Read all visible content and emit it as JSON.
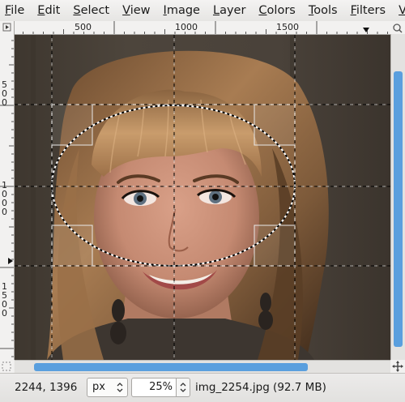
{
  "menubar": {
    "items": [
      {
        "mnemonic": "F",
        "rest": "ile"
      },
      {
        "mnemonic": "E",
        "rest": "dit"
      },
      {
        "mnemonic": "S",
        "rest": "elect"
      },
      {
        "mnemonic": "V",
        "rest": "iew"
      },
      {
        "mnemonic": "I",
        "rest": "mage"
      },
      {
        "mnemonic": "L",
        "rest": "ayer"
      },
      {
        "mnemonic": "C",
        "rest": "olors"
      },
      {
        "mnemonic": "T",
        "rest": "ools"
      },
      {
        "mnemonic": "F",
        "rest": "ilters"
      },
      {
        "mnemonic": "V",
        "rest": "ideo"
      }
    ]
  },
  "rulers": {
    "top_labels": [
      "500",
      "1000",
      "1500"
    ],
    "left_labels": [
      "500",
      "1000",
      "1500"
    ]
  },
  "status": {
    "coordinates": "2244, 1396",
    "unit": "px",
    "zoom": "25",
    "zoom_unit": "%",
    "file_info": "img_2254.jpg (92.7 MB)"
  },
  "scroll": {
    "horizontal_fraction": 0.73,
    "vertical_fraction": 0.85
  },
  "icons": {
    "ruler_corner": "menu-triangle-icon",
    "navigate": "navigate-cross-icon",
    "quick_mask": "quick-mask-icon",
    "zoom_lock": "zoom-lock-icon"
  },
  "colors": {
    "scrollbar_thumb": "#5a9fde",
    "guide_line": "#000000",
    "selection": "#ffffff"
  }
}
